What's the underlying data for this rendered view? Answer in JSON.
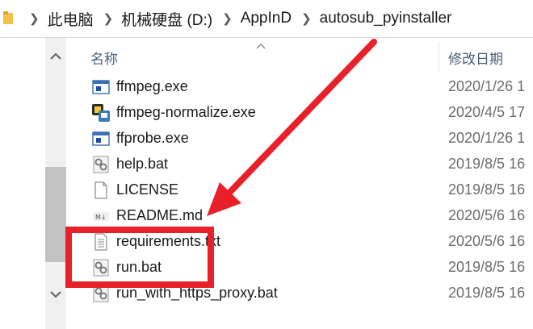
{
  "address_bar": {
    "crumbs": [
      {
        "label": "此电脑"
      },
      {
        "label": "机械硬盘 (D:)"
      },
      {
        "label": "AppInD"
      },
      {
        "label": "autosub_pyinstaller"
      }
    ]
  },
  "columns": {
    "name": "名称",
    "date_modified": "修改日期"
  },
  "files": [
    {
      "name": "ffmpeg.exe",
      "date": "2020/1/26 1",
      "icon": "exe-window-icon"
    },
    {
      "name": "ffmpeg-normalize.exe",
      "date": "2020/4/5 17",
      "icon": "python-exe-icon"
    },
    {
      "name": "ffprobe.exe",
      "date": "2020/1/26 1",
      "icon": "exe-window-icon"
    },
    {
      "name": "help.bat",
      "date": "2019/8/5 16",
      "icon": "batch-gear-icon"
    },
    {
      "name": "LICENSE",
      "date": "2019/8/5 16",
      "icon": "blank-file-icon"
    },
    {
      "name": "README.md",
      "date": "2020/5/6 16",
      "icon": "markdown-icon"
    },
    {
      "name": "requirements.txt",
      "date": "2020/5/6 16",
      "icon": "text-file-icon"
    },
    {
      "name": "run.bat",
      "date": "2019/8/5 16",
      "icon": "batch-gear-icon"
    },
    {
      "name": "run_with_https_proxy.bat",
      "date": "2019/8/5 16",
      "icon": "batch-gear-icon"
    }
  ],
  "annotation": {
    "color": "#e8202a",
    "highlighted_files": [
      "requirements.txt",
      "run.bat"
    ]
  }
}
